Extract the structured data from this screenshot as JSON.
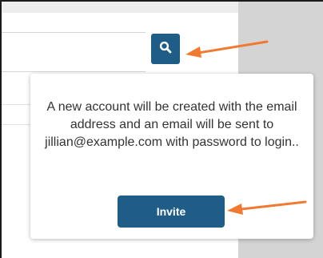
{
  "popover": {
    "message": "A new account will be created with the email address and an email will be sent to jillian@example.com with password to login..",
    "invite_label": "Invite"
  },
  "icons": {
    "search": "search-icon",
    "arrow": "arrow-annotation"
  },
  "colors": {
    "primary": "#1f5d86",
    "annotation": "#f07a32",
    "side_panel": "#d4d4d4"
  }
}
